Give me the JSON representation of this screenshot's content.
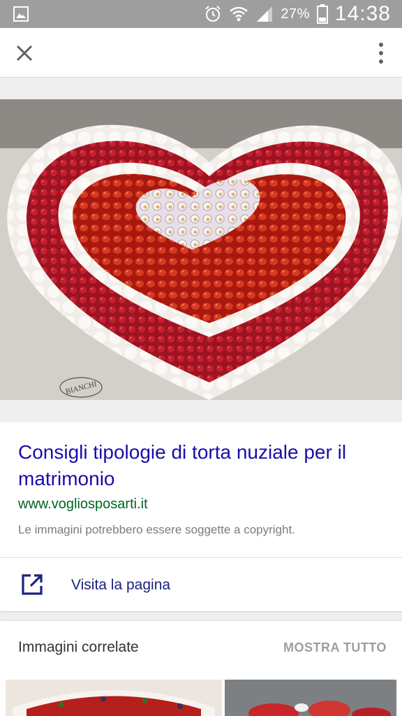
{
  "status_bar": {
    "battery_percent": "27%",
    "time": "14:38",
    "icons": [
      "gallery-icon",
      "alarm-icon",
      "wifi-icon",
      "signal-icon",
      "battery-icon"
    ]
  },
  "app_bar": {
    "icons": [
      "close-icon",
      "more-vert-icon"
    ]
  },
  "result": {
    "title": "Consigli tipologie di torta nuziale per il matrimonio",
    "url": "www.vogliosposarti.it",
    "copyright_note": "Le immagini potrebbero essere soggette a copyright.",
    "visit_label": "Visita la pagina",
    "image_watermark": "BIANCHI"
  },
  "related": {
    "title": "Immagini correlate",
    "show_all_label": "MOSTRA TUTTO"
  },
  "colors": {
    "title_link": "#1a0dab",
    "url_green": "#006621",
    "status_bar_bg": "#9e9e9e"
  }
}
